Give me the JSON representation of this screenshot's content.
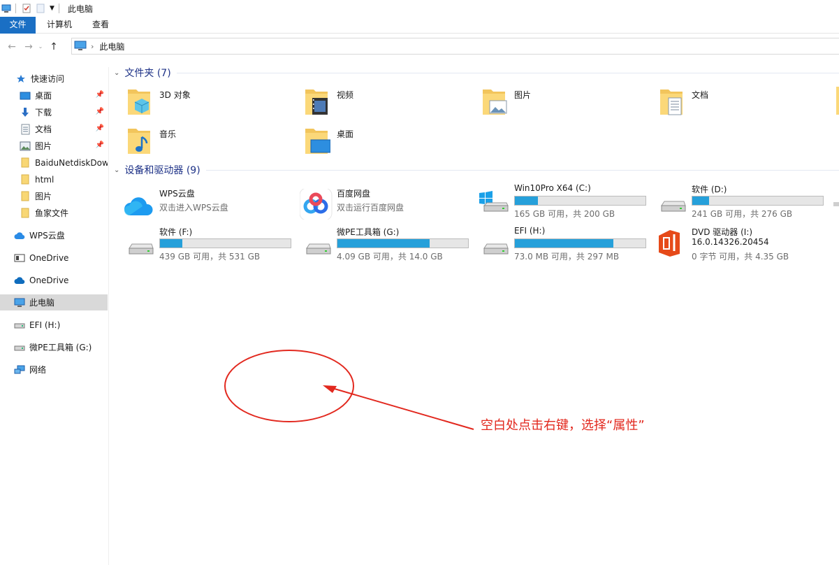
{
  "window": {
    "title": "此电脑"
  },
  "ribbon": {
    "tabs": [
      "文件",
      "计算机",
      "查看"
    ]
  },
  "address": {
    "path": "此电脑"
  },
  "sidebar": {
    "items": [
      {
        "label": "快速访问"
      },
      {
        "label": "桌面"
      },
      {
        "label": "下载"
      },
      {
        "label": "文档"
      },
      {
        "label": "图片"
      },
      {
        "label": "BaiduNetdiskDow"
      },
      {
        "label": "html"
      },
      {
        "label": "图片"
      },
      {
        "label": "鱼家文件"
      },
      {
        "label": "WPS云盘"
      },
      {
        "label": "OneDrive"
      },
      {
        "label": "OneDrive"
      },
      {
        "label": "此电脑"
      },
      {
        "label": "EFI (H:)"
      },
      {
        "label": "微PE工具箱 (G:)"
      },
      {
        "label": "网络"
      }
    ]
  },
  "folders": {
    "header": "文件夹 (7)",
    "items": [
      {
        "label": "3D 对象"
      },
      {
        "label": "视频"
      },
      {
        "label": "图片"
      },
      {
        "label": "文档"
      },
      {
        "label": "音乐"
      },
      {
        "label": "桌面"
      }
    ]
  },
  "devices": {
    "header": "设备和驱动器 (9)",
    "items": [
      {
        "name": "WPS云盘",
        "sub": "双击进入WPS云盘"
      },
      {
        "name": "百度网盘",
        "sub": "双击运行百度网盘"
      },
      {
        "name": "Win10Pro X64 (C:)",
        "space": "165 GB 可用，共 200 GB",
        "used_fraction": 0.175
      },
      {
        "name": "软件 (D:)",
        "space": "241 GB 可用，共 276 GB",
        "used_fraction": 0.127
      },
      {
        "name": "软件 (F:)",
        "space": "439 GB 可用，共 531 GB",
        "used_fraction": 0.173
      },
      {
        "name": "微PE工具箱 (G:)",
        "space": "4.09 GB 可用，共 14.0 GB",
        "used_fraction": 0.708
      },
      {
        "name": "EFI (H:)",
        "space": "73.0 MB 可用，共 297 MB",
        "used_fraction": 0.754
      },
      {
        "name": "DVD 驱动器 (I:)",
        "sub": "16.0.14326.20454",
        "space": "0 字节 可用，共 4.35 GB"
      }
    ]
  },
  "annotation": {
    "text": "空白处点击右键，选择“属性”",
    "color": "#e2281e"
  }
}
